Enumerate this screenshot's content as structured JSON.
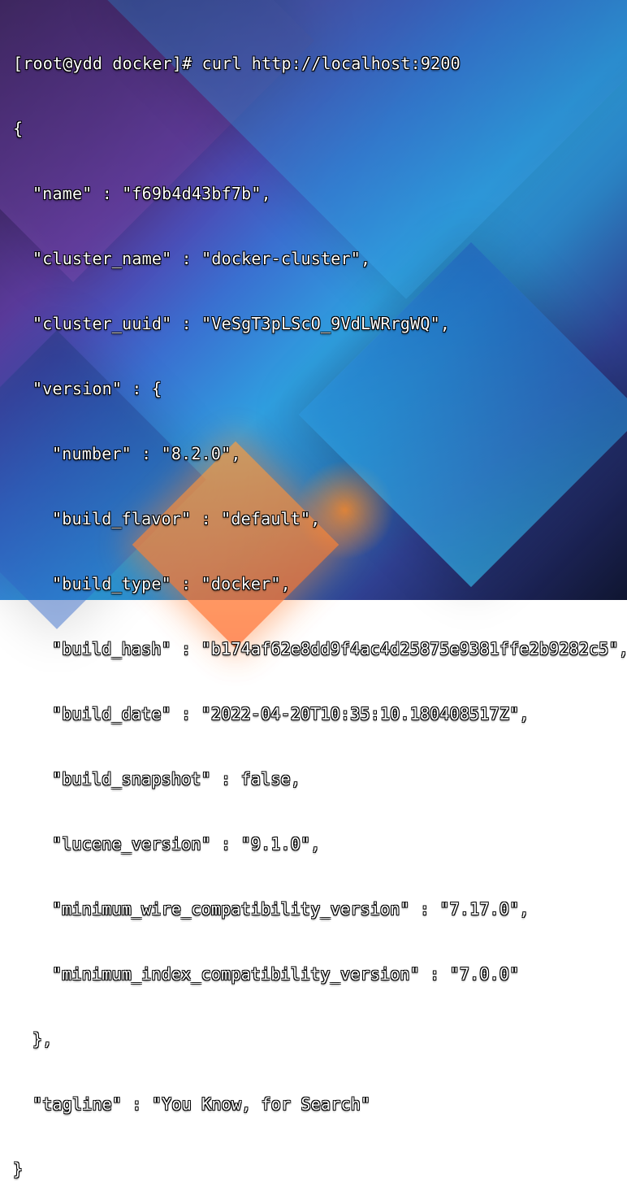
{
  "prompt": {
    "prefix": "[root@ydd docker]# ",
    "command": "curl http://localhost:9200"
  },
  "json": {
    "name_key": "\"name\"",
    "name_val": "\"f69b4d43bf7b\"",
    "cluster_name_key": "\"cluster_name\"",
    "cluster_name_val": "\"docker-cluster\"",
    "cluster_uuid_key": "\"cluster_uuid\"",
    "cluster_uuid_val": "\"VeSgT3pLScO_9VdLWRrgWQ\"",
    "version_key": "\"version\"",
    "number_key": "\"number\"",
    "number_val": "\"8.2.0\"",
    "build_flavor_key": "\"build_flavor\"",
    "build_flavor_val": "\"default\"",
    "build_type_key": "\"build_type\"",
    "build_type_val": "\"docker\"",
    "build_hash_key": "\"build_hash\"",
    "build_hash_val": "\"b174af62e8dd9f4ac4d25875e9381ffe2b9282c5\"",
    "build_date_key": "\"build_date\"",
    "build_date_val": "\"2022-04-20T10:35:10.180408517Z\"",
    "build_snapshot_key": "\"build_snapshot\"",
    "build_snapshot_val": "false",
    "lucene_version_key": "\"lucene_version\"",
    "lucene_version_val": "\"9.1.0\"",
    "min_wire_key": "\"minimum_wire_compatibility_version\"",
    "min_wire_val": "\"7.17.0\"",
    "min_index_key": "\"minimum_index_compatibility_version\"",
    "min_index_val": "\"7.0.0\"",
    "tagline_key": "\"tagline\"",
    "tagline_val": "\"You Know, for Search\""
  },
  "punct": {
    "open_brace": "{",
    "close_brace": "}",
    "close_brace_comma": "},",
    "colon_open_brace": " : {",
    "sep": " : ",
    "comma": ","
  }
}
